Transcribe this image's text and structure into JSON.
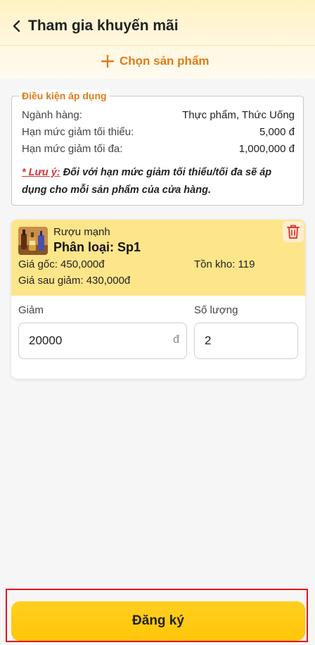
{
  "header": {
    "title": "Tham gia khuyến mãi",
    "choose_product_label": "Chọn sản phẩm"
  },
  "conditions": {
    "legend": "Điều kiện áp dụng",
    "rows": [
      {
        "label": "Ngành hàng:",
        "value": "Thực phẩm, Thức Uống"
      },
      {
        "label": "Hạn mức giảm tối thiểu:",
        "value": "5,000 đ"
      },
      {
        "label": "Hạn mức giảm tối đa:",
        "value": "1,000,000 đ"
      }
    ],
    "note_label": "* Lưu ý:",
    "note_text": " Đối với hạn mức giảm tối thiểu/tối đa sẽ áp dụng cho mỗi sản phẩm của cửa hàng."
  },
  "product": {
    "name": "Rượu mạnh",
    "variant": "Phân loại: Sp1",
    "original_price": "Giá gốc: 450,000đ",
    "stock": "Tồn kho: 119",
    "discounted_price": "Giá sau giảm: 430,000đ",
    "discount_label": "Giảm",
    "discount_value": "20000",
    "currency": "đ",
    "quantity_label": "Số lượng",
    "quantity_value": "2"
  },
  "footer": {
    "submit_label": "Đăng ký"
  },
  "colors": {
    "accent": "#e07b16",
    "primary_button": "#ffc60a",
    "highlight": "#fde58a",
    "warning": "#d63636"
  }
}
